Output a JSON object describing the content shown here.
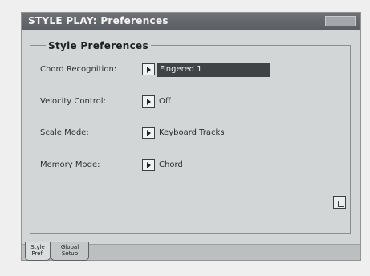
{
  "window": {
    "title": "STYLE PLAY: Preferences"
  },
  "section": {
    "title": "Style Preferences"
  },
  "rows": [
    {
      "label": "Chord Recognition:",
      "value": "Fingered 1"
    },
    {
      "label": "Velocity Control:",
      "value": "Off"
    },
    {
      "label": "Scale Mode:",
      "value": "Keyboard Tracks"
    },
    {
      "label": "Memory Mode:",
      "value": "Chord"
    }
  ],
  "tabs": [
    {
      "line1": "Style",
      "line2": "Pref."
    },
    {
      "line1": "Global",
      "line2": "Setup"
    }
  ],
  "icons": {
    "arrow": "play-arrow-icon",
    "corner": "page-menu-icon"
  },
  "colors": {
    "titlebar": "#5f6367",
    "selection": "#3f4346",
    "background": "#d3d6d6"
  }
}
